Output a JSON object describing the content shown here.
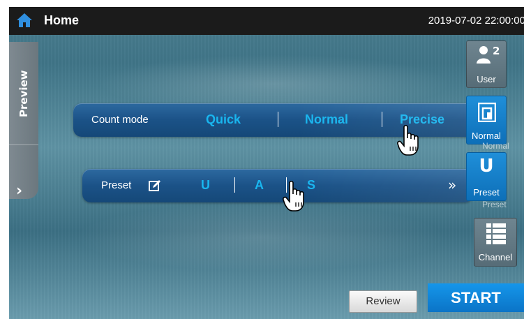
{
  "topbar": {
    "title": "Home",
    "datetime": "2019-07-02 22:00:00"
  },
  "sidebar": {
    "preview_label": "Preview",
    "expand_glyph": "›"
  },
  "count_mode": {
    "label": "Count mode",
    "options": [
      "Quick",
      "Normal",
      "Precise"
    ],
    "selected": "Precise"
  },
  "preset": {
    "label": "Preset",
    "options": [
      "U",
      "A",
      "S"
    ],
    "more_glyph": "»"
  },
  "right_buttons": {
    "user": {
      "badge": "2",
      "label": "User"
    },
    "normal": {
      "label": "Normal",
      "ghost_label": "Normal"
    },
    "preset": {
      "glyph": "U",
      "label": "Preset",
      "ghost_label": "Preset"
    },
    "channel": {
      "label": "Channel"
    }
  },
  "actions": {
    "review": "Review",
    "start": "START"
  },
  "colors": {
    "accent": "#19b6ef",
    "topbar": "#1b1b1b",
    "bar": "#1b5287",
    "start": "#0b74c7"
  },
  "icons": [
    "home-icon",
    "edit-icon",
    "user-icon",
    "normal-mode-icon",
    "channel-list-icon",
    "hand-cursor-icon"
  ]
}
